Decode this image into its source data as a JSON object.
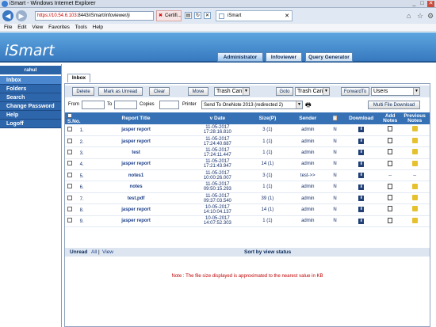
{
  "window": {
    "title": "iSmart - Windows Internet Explorer",
    "min": "_",
    "max": "□",
    "close": "✕"
  },
  "browser": {
    "url_prefix": "https://10.54.6.103",
    "url_rest": ":8443/iSmart/infoviewer/ji",
    "cert_tab": "Certifi...",
    "page_tab": "iSmart",
    "menu": [
      "File",
      "Edit",
      "View",
      "Favorites",
      "Tools",
      "Help"
    ]
  },
  "app": {
    "logo": "iSmart",
    "tabs": [
      "Administrator",
      "Infoviewer",
      "Query Generator"
    ]
  },
  "sidebar": {
    "user": "rahul",
    "items": [
      "Inbox",
      "Folders",
      "Search",
      "Change Password",
      "Help",
      "Logoff"
    ]
  },
  "inbox": {
    "tab_label": "Inbox",
    "toolbar": {
      "delete": "Delete",
      "mark_unread": "Mark as Unread",
      "clear": "Clear",
      "move": "Move",
      "move_target": "Trash Can",
      "goto": "Goto",
      "goto_target": "Trash Can",
      "forward": "ForwardTo",
      "forward_target": "Users"
    },
    "filter": {
      "from": "From",
      "to": "To",
      "copies": "Copies",
      "printer": "Printer",
      "printer_value": "Send To OneNote 2013 (redirected 2)",
      "multi_download": "Multi File Download"
    },
    "columns": [
      "S.No.",
      "Report Title",
      "v Date",
      "Size(P)",
      "Sender",
      "",
      "Download",
      "Add Notes",
      "Previous Notes"
    ],
    "rows": [
      {
        "sno": "1.",
        "title": "jasper report",
        "date": "11-05-2017",
        "time": "17:28:16.810",
        "size": "3 (1)",
        "sender": "admin",
        "flag": "N",
        "add": true,
        "prev": true
      },
      {
        "sno": "2.",
        "title": "jasper report",
        "date": "11-05-2017",
        "time": "17:24:40.687",
        "size": "1 (1)",
        "sender": "admin",
        "flag": "N",
        "add": true,
        "prev": true
      },
      {
        "sno": "3.",
        "title": "test",
        "date": "11-05-2017",
        "time": "17:24:11.447",
        "size": "1 (1)",
        "sender": "admin",
        "flag": "N",
        "add": true,
        "prev": true
      },
      {
        "sno": "4.",
        "title": "jasper report",
        "date": "11-05-2017",
        "time": "17:21:43.947",
        "size": "14 (1)",
        "sender": "admin",
        "flag": "N",
        "add": true,
        "prev": true
      },
      {
        "sno": "5.",
        "title": "notes1",
        "date": "11-05-2017",
        "time": "10:00:26.007",
        "size": "3 (1)",
        "sender": "test->>",
        "flag": "N",
        "add": false,
        "prev": false
      },
      {
        "sno": "6.",
        "title": "notes",
        "date": "11-05-2017",
        "time": "09:50:15.293",
        "size": "1 (1)",
        "sender": "admin",
        "flag": "N",
        "add": true,
        "prev": true
      },
      {
        "sno": "7.",
        "title": "test.pdf",
        "date": "11-05-2017",
        "time": "09:37:03.540",
        "size": "39 (1)",
        "sender": "admin",
        "flag": "N",
        "add": true,
        "prev": true
      },
      {
        "sno": "8.",
        "title": "jasper report",
        "date": "10-05-2017",
        "time": "14:10:04.137",
        "size": "14 (1)",
        "sender": "admin",
        "flag": "N",
        "add": true,
        "prev": true
      },
      {
        "sno": "9.",
        "title": "jasper report",
        "date": "10-05-2017",
        "time": "14:07:52.303",
        "size": "1 (1)",
        "sender": "admin",
        "flag": "N",
        "add": true,
        "prev": true
      }
    ],
    "footer": {
      "unread": "Unread",
      "all": "All",
      "sep": "|",
      "view": "View",
      "sort": "Sort by view status"
    },
    "note": "Note : The file size displayed is approximated to the nearest value in KB"
  }
}
